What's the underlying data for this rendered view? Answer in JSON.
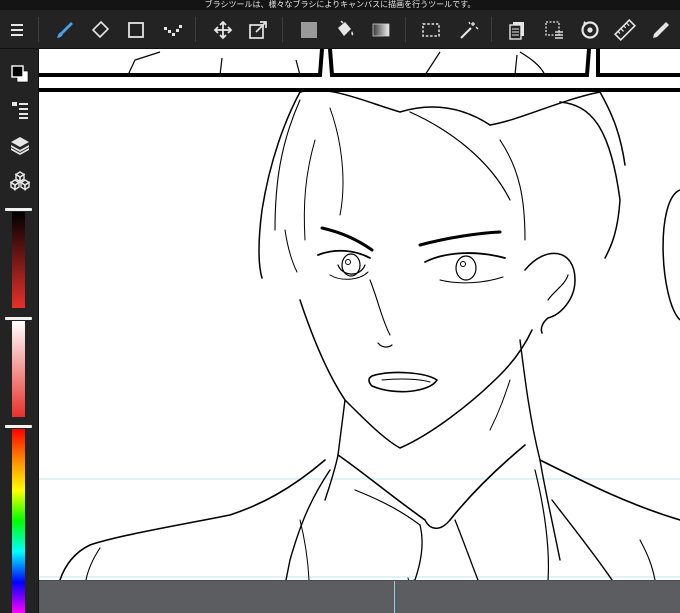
{
  "status_hint": "ブラシツールは、様々なブラシによりキャンバスに描画を行うツールです。",
  "colors": {
    "accent": "#4aa3e6",
    "foreground": "#000000",
    "background": "#ffffff",
    "brightness_slider_color": "#e8302a",
    "opacity_slider_color": "#e8302a"
  },
  "toolbar": {
    "items": [
      {
        "icon": "menu-icon",
        "selected": false
      },
      {
        "icon": "brush-icon",
        "selected": true
      },
      {
        "icon": "eraser-icon",
        "selected": false
      },
      {
        "icon": "rectangle-icon",
        "selected": false
      },
      {
        "icon": "dot-brush-icon",
        "selected": false
      },
      {
        "icon": "move-icon",
        "selected": false
      },
      {
        "icon": "transform-icon",
        "selected": false
      },
      {
        "icon": "fill-color-icon",
        "selected": false
      },
      {
        "icon": "bucket-icon",
        "selected": false
      },
      {
        "icon": "gradient-icon",
        "selected": false
      },
      {
        "icon": "selection-icon",
        "selected": false
      },
      {
        "icon": "magic-wand-icon",
        "selected": false
      },
      {
        "icon": "copy-icon",
        "selected": false
      },
      {
        "icon": "select-layer-icon",
        "selected": false
      },
      {
        "icon": "rotate-icon",
        "selected": false
      },
      {
        "icon": "ruler-icon",
        "selected": false
      },
      {
        "icon": "eyedropper-icon",
        "selected": false
      }
    ]
  },
  "sidebar": {
    "items": [
      {
        "icon": "color-swap-icon"
      },
      {
        "icon": "brush-list-icon"
      },
      {
        "icon": "layers-icon"
      },
      {
        "icon": "materials-icon"
      }
    ],
    "sliders": [
      {
        "name": "brightness",
        "value": 0.0
      },
      {
        "name": "opacity",
        "value": 1.0
      },
      {
        "name": "hue",
        "value": 0.0
      }
    ]
  }
}
